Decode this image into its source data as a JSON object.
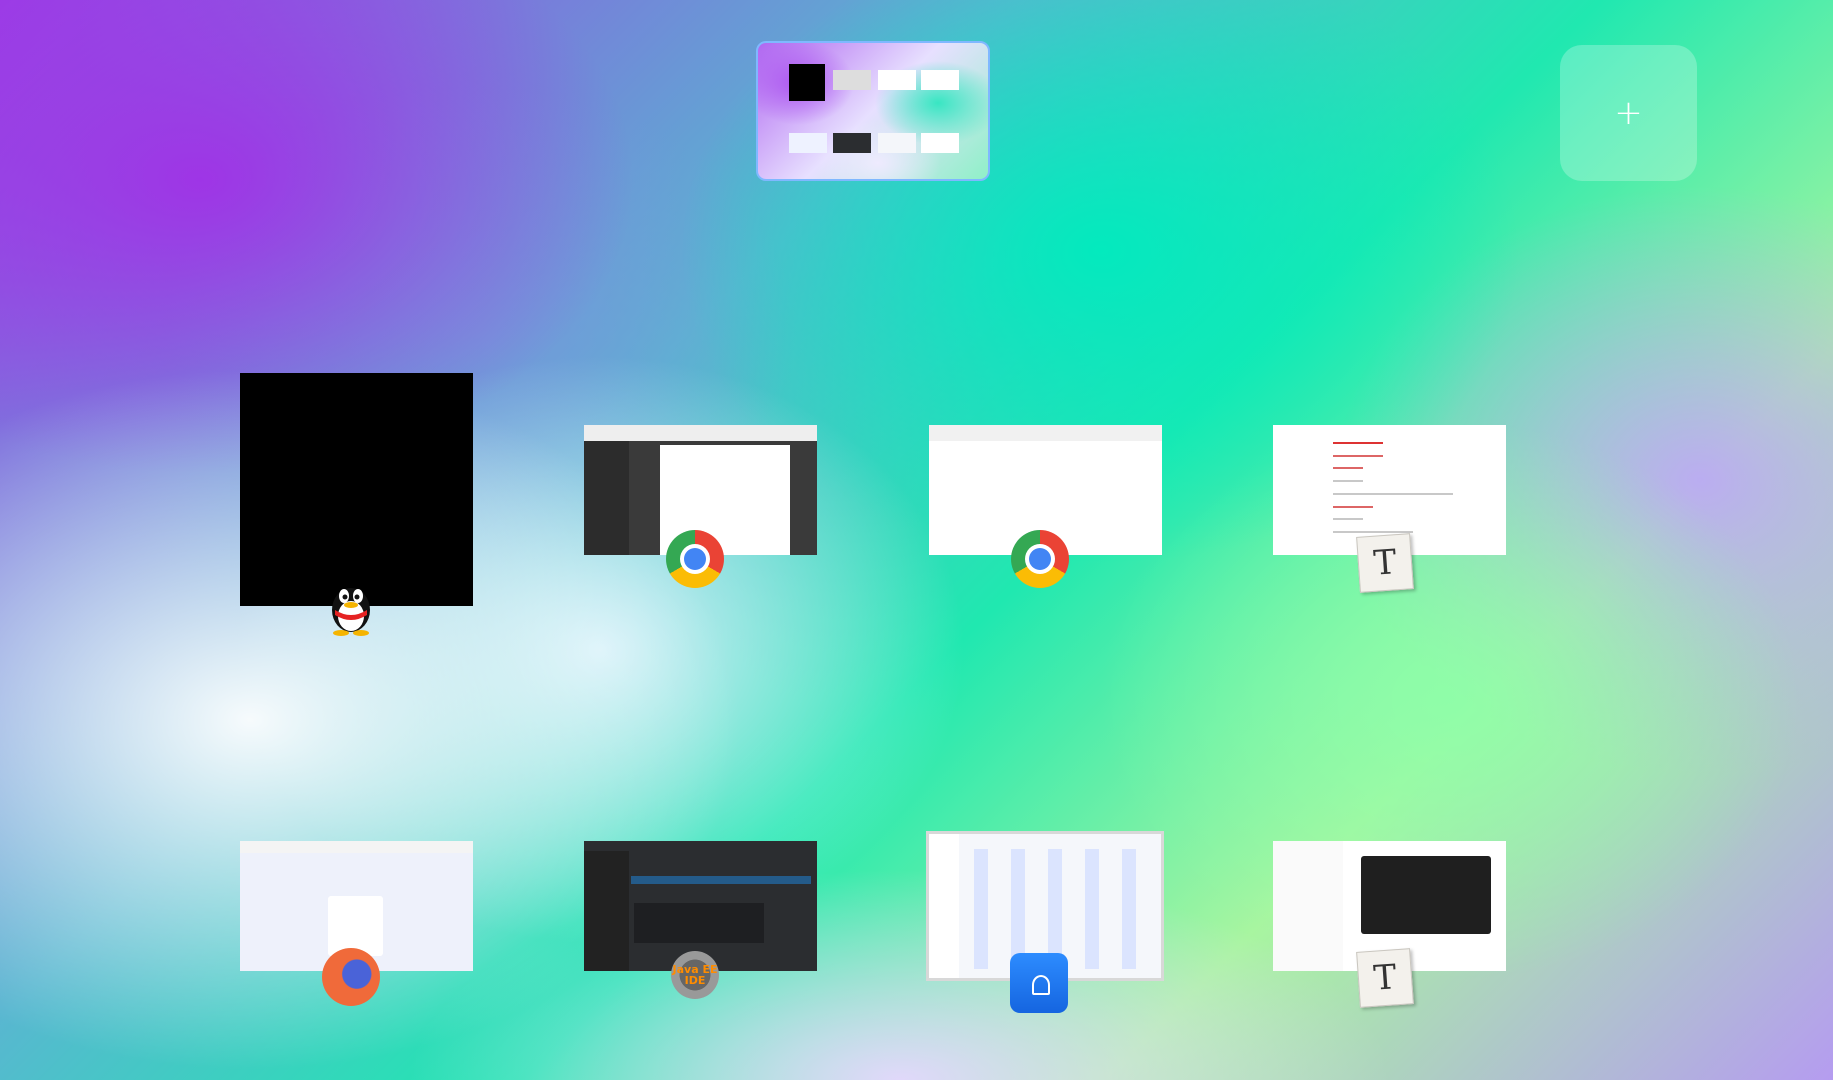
{
  "add_workspace": {
    "label": "+"
  },
  "windows": [
    {
      "app": "QQ",
      "icon": "qq-penguin-icon"
    },
    {
      "app": "Chrome",
      "icon": "chrome-icon"
    },
    {
      "app": "Chrome",
      "icon": "chrome-icon"
    },
    {
      "app": "Typora",
      "icon": "typora-icon",
      "icon_text": "T"
    },
    {
      "app": "Firefox",
      "icon": "firefox-icon"
    },
    {
      "app": "Java EE IDE",
      "icon": "java-ee-ide-icon",
      "icon_text": "Java EE\nIDE"
    },
    {
      "app": "File Manager",
      "icon": "file-manager-icon"
    },
    {
      "app": "Typora",
      "icon": "typora-icon",
      "icon_text": "T"
    }
  ]
}
